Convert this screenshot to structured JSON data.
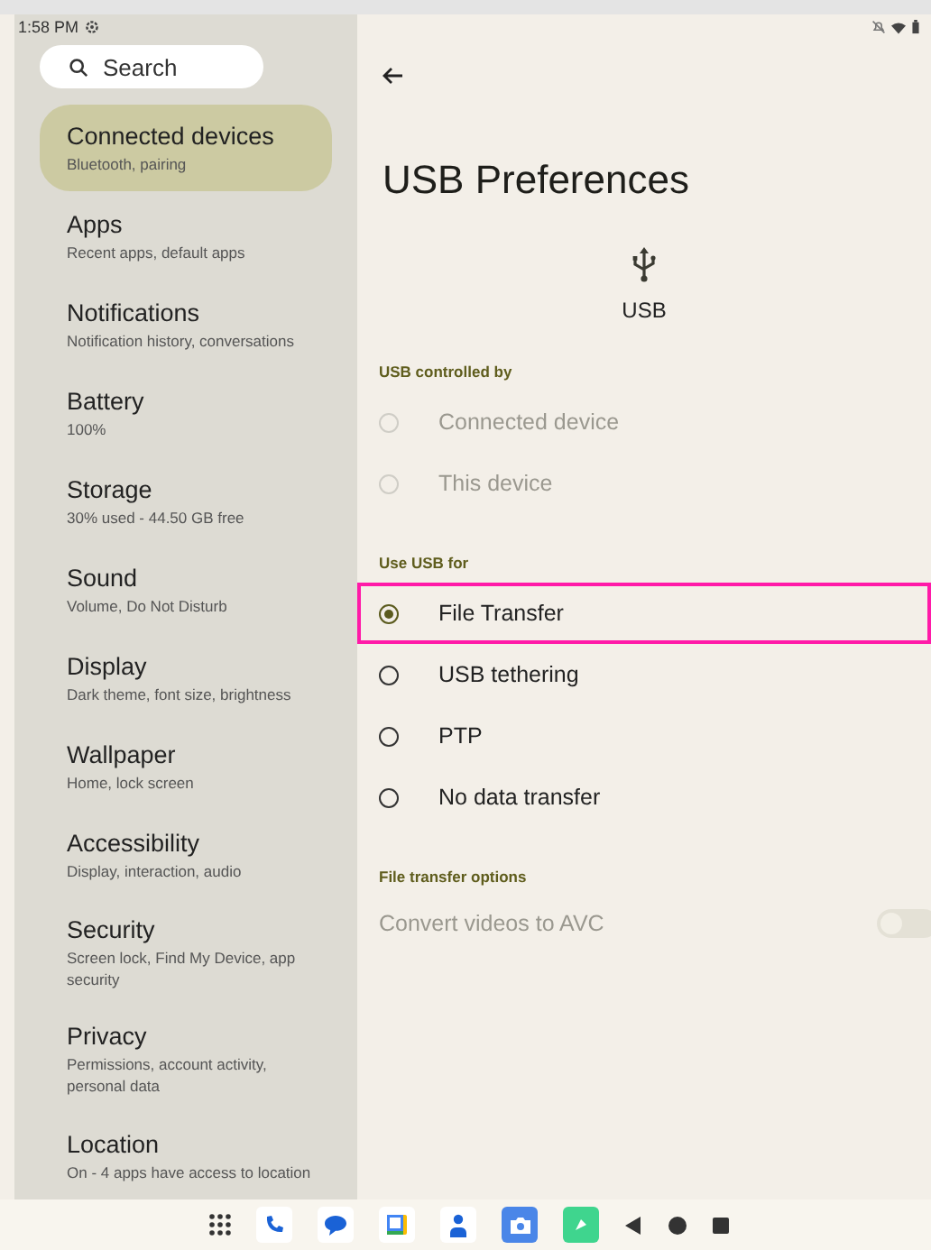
{
  "status_bar": {
    "time": "1:58 PM"
  },
  "sidebar": {
    "search": {
      "placeholder": "Search"
    },
    "items": [
      {
        "title": "Connected devices",
        "subtitle": "Bluetooth, pairing",
        "selected": true
      },
      {
        "title": "Apps",
        "subtitle": "Recent apps, default apps",
        "selected": false
      },
      {
        "title": "Notifications",
        "subtitle": "Notification history, conversations",
        "selected": false
      },
      {
        "title": "Battery",
        "subtitle": "100%",
        "selected": false
      },
      {
        "title": "Storage",
        "subtitle": "30% used - 44.50 GB free",
        "selected": false
      },
      {
        "title": "Sound",
        "subtitle": "Volume, Do Not Disturb",
        "selected": false
      },
      {
        "title": "Display",
        "subtitle": "Dark theme, font size, brightness",
        "selected": false
      },
      {
        "title": "Wallpaper",
        "subtitle": "Home, lock screen",
        "selected": false
      },
      {
        "title": "Accessibility",
        "subtitle": "Display, interaction, audio",
        "selected": false
      },
      {
        "title": "Security",
        "subtitle": "Screen lock, Find My Device, app security",
        "selected": false
      },
      {
        "title": "Privacy",
        "subtitle": "Permissions, account activity, personal data",
        "selected": false
      },
      {
        "title": "Location",
        "subtitle": "On - 4 apps have access to location",
        "selected": false
      }
    ]
  },
  "page": {
    "title": "USB Preferences",
    "header_label": "USB",
    "sections": [
      {
        "title": "USB controlled by",
        "kind": "radio",
        "options": [
          {
            "label": "Connected device",
            "selected": false,
            "disabled": true,
            "highlighted": false
          },
          {
            "label": "This device",
            "selected": false,
            "disabled": true,
            "highlighted": false
          }
        ]
      },
      {
        "title": "Use USB for",
        "kind": "radio",
        "options": [
          {
            "label": "File Transfer",
            "selected": true,
            "disabled": false,
            "highlighted": true
          },
          {
            "label": "USB tethering",
            "selected": false,
            "disabled": false,
            "highlighted": false
          },
          {
            "label": "PTP",
            "selected": false,
            "disabled": false,
            "highlighted": false
          },
          {
            "label": "No data transfer",
            "selected": false,
            "disabled": false,
            "highlighted": false
          }
        ]
      },
      {
        "title": "File transfer options",
        "kind": "switch",
        "options": [
          {
            "label": "Convert videos to AVC",
            "on": false,
            "disabled": true
          }
        ]
      }
    ]
  }
}
